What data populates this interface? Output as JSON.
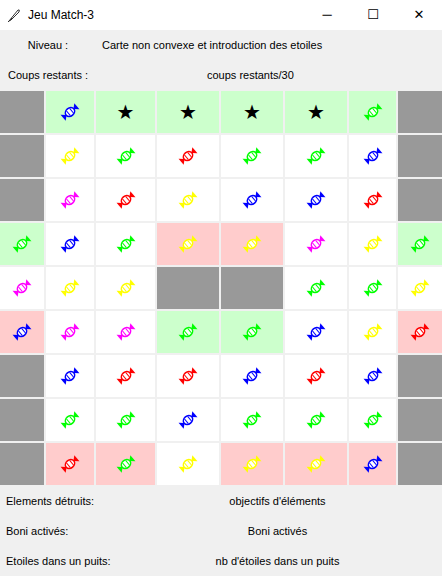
{
  "window": {
    "title": "Jeu Match-3",
    "controls": [
      "─",
      "☐",
      "✕"
    ]
  },
  "info": [
    {
      "label": "Niveau :",
      "value": "Carte non convexe et introduction des etoiles"
    },
    {
      "label": "Coups restants :",
      "value": "coups restants/30"
    }
  ],
  "board": {
    "rows": [
      [
        {
          "kind": "wall",
          "background": "#999999"
        },
        {
          "kind": "candy",
          "color": "#0000ff",
          "background": "#ccffcc"
        },
        {
          "kind": "star",
          "text": "★",
          "background": "#ccffcc"
        },
        {
          "kind": "star",
          "text": "★",
          "background": "#ccffcc"
        },
        {
          "kind": "star",
          "text": "★",
          "background": "#ccffcc"
        },
        {
          "kind": "star",
          "text": "★",
          "background": "#ccffcc"
        },
        {
          "kind": "candy",
          "color": "#00ff00",
          "background": "#ccffcc"
        },
        {
          "kind": "wall",
          "background": "#999999"
        }
      ],
      [
        {
          "kind": "wall",
          "background": "#999999"
        },
        {
          "kind": "candy",
          "color": "#ffff00",
          "background": "#ffffff"
        },
        {
          "kind": "candy",
          "color": "#00ff00",
          "background": "#ffffff"
        },
        {
          "kind": "candy",
          "color": "#ff0000",
          "background": "#ffffff"
        },
        {
          "kind": "candy",
          "color": "#00ff00",
          "background": "#ffffff"
        },
        {
          "kind": "candy",
          "color": "#00ff00",
          "background": "#ffffff"
        },
        {
          "kind": "candy",
          "color": "#0000ff",
          "background": "#ffffff"
        },
        {
          "kind": "wall",
          "background": "#999999"
        }
      ],
      [
        {
          "kind": "wall",
          "background": "#999999"
        },
        {
          "kind": "candy",
          "color": "#ff00ff",
          "background": "#ffffff"
        },
        {
          "kind": "candy",
          "color": "#ff0000",
          "background": "#ffffff"
        },
        {
          "kind": "candy",
          "color": "#ffff00",
          "background": "#ffffff"
        },
        {
          "kind": "candy",
          "color": "#0000ff",
          "background": "#ffffff"
        },
        {
          "kind": "candy",
          "color": "#0000ff",
          "background": "#ffffff"
        },
        {
          "kind": "candy",
          "color": "#ff0000",
          "background": "#ffffff"
        },
        {
          "kind": "wall",
          "background": "#999999"
        }
      ],
      [
        {
          "kind": "candy",
          "color": "#00ff00",
          "background": "#ccffcc"
        },
        {
          "kind": "candy",
          "color": "#0000ff",
          "background": "#ffffff"
        },
        {
          "kind": "candy",
          "color": "#00ff00",
          "background": "#ffffff"
        },
        {
          "kind": "candy",
          "color": "#ffff00",
          "background": "#ffcccc"
        },
        {
          "kind": "candy",
          "color": "#ffff00",
          "background": "#ffcccc"
        },
        {
          "kind": "candy",
          "color": "#ff00ff",
          "background": "#ffffff"
        },
        {
          "kind": "candy",
          "color": "#ffff00",
          "background": "#ffffff"
        },
        {
          "kind": "candy",
          "color": "#00ff00",
          "background": "#ccffcc"
        }
      ],
      [
        {
          "kind": "candy",
          "color": "#ff00ff",
          "background": "#ffffff"
        },
        {
          "kind": "candy",
          "color": "#ffff00",
          "background": "#ffffff"
        },
        {
          "kind": "candy",
          "color": "#ffff00",
          "background": "#ffffff"
        },
        {
          "kind": "wall",
          "background": "#999999"
        },
        {
          "kind": "wall",
          "background": "#999999"
        },
        {
          "kind": "candy",
          "color": "#00ff00",
          "background": "#ffffff"
        },
        {
          "kind": "candy",
          "color": "#00ff00",
          "background": "#ffffff"
        },
        {
          "kind": "candy",
          "color": "#ffff00",
          "background": "#ffffff"
        }
      ],
      [
        {
          "kind": "candy",
          "color": "#0000ff",
          "background": "#ffcccc"
        },
        {
          "kind": "candy",
          "color": "#ff00ff",
          "background": "#ffffff"
        },
        {
          "kind": "candy",
          "color": "#ff00ff",
          "background": "#ffffff"
        },
        {
          "kind": "candy",
          "color": "#00ff00",
          "background": "#ccffcc"
        },
        {
          "kind": "candy",
          "color": "#00ff00",
          "background": "#ccffcc"
        },
        {
          "kind": "candy",
          "color": "#0000ff",
          "background": "#ffffff"
        },
        {
          "kind": "candy",
          "color": "#ffff00",
          "background": "#ffffff"
        },
        {
          "kind": "candy",
          "color": "#ff0000",
          "background": "#ffcccc"
        }
      ],
      [
        {
          "kind": "wall",
          "background": "#999999"
        },
        {
          "kind": "candy",
          "color": "#0000ff",
          "background": "#ffffff"
        },
        {
          "kind": "candy",
          "color": "#ff0000",
          "background": "#ffffff"
        },
        {
          "kind": "candy",
          "color": "#ff0000",
          "background": "#ffffff"
        },
        {
          "kind": "candy",
          "color": "#0000ff",
          "background": "#ffffff"
        },
        {
          "kind": "candy",
          "color": "#ff0000",
          "background": "#ffffff"
        },
        {
          "kind": "candy",
          "color": "#0000ff",
          "background": "#ffffff"
        },
        {
          "kind": "wall",
          "background": "#999999"
        }
      ],
      [
        {
          "kind": "wall",
          "background": "#999999"
        },
        {
          "kind": "candy",
          "color": "#00ff00",
          "background": "#ffffff"
        },
        {
          "kind": "candy",
          "color": "#00ff00",
          "background": "#ffffff"
        },
        {
          "kind": "candy",
          "color": "#0000ff",
          "background": "#ffffff"
        },
        {
          "kind": "candy",
          "color": "#00ff00",
          "background": "#ffffff"
        },
        {
          "kind": "candy",
          "color": "#00ff00",
          "background": "#ffffff"
        },
        {
          "kind": "candy",
          "color": "#00ff00",
          "background": "#ffffff"
        },
        {
          "kind": "wall",
          "background": "#999999"
        }
      ],
      [
        {
          "kind": "wall",
          "background": "#999999"
        },
        {
          "kind": "candy",
          "color": "#ff0000",
          "background": "#ffcccc"
        },
        {
          "kind": "candy",
          "color": "#00ff00",
          "background": "#ffcccc"
        },
        {
          "kind": "candy",
          "color": "#ffff00",
          "background": "#ffffff"
        },
        {
          "kind": "candy",
          "color": "#ffff00",
          "background": "#ffcccc"
        },
        {
          "kind": "candy",
          "color": "#ffff00",
          "background": "#ffcccc"
        },
        {
          "kind": "candy",
          "color": "#0000ff",
          "background": "#ffcccc"
        },
        {
          "kind": "wall",
          "background": "#999999"
        }
      ]
    ]
  },
  "stats": [
    {
      "label": "Elements détruits:",
      "value": "objectifs d'éléments"
    },
    {
      "label": "Boni activés:",
      "value": "Boni activés"
    },
    {
      "label": "Etoiles dans un puits:",
      "value": "nb d'étoiles dans un puits"
    }
  ]
}
